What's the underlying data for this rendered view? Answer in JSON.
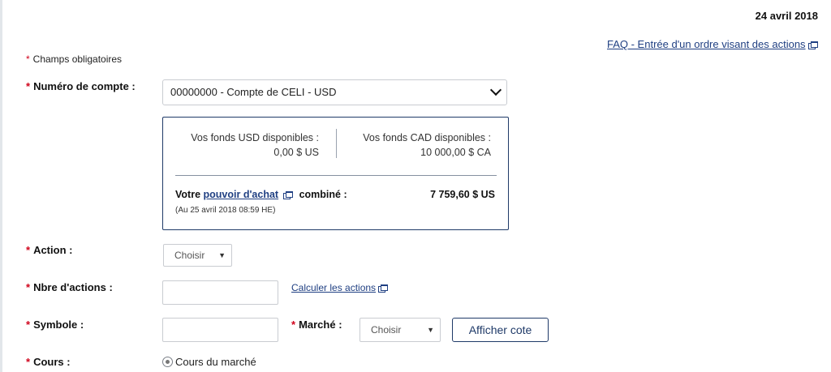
{
  "date": "24  avril 2018",
  "faq_link": "FAQ - Entrée d'un ordre visant des actions",
  "required_note": "Champs obligatoires",
  "required_marker": "*",
  "account": {
    "label": "Numéro de compte :",
    "selected": "00000000 - Compte de CELI - USD"
  },
  "funds": {
    "usd_label": "Vos fonds USD disponibles :",
    "usd_value": "0,00 $ US",
    "cad_label": "Vos fonds CAD disponibles :",
    "cad_value": "10 000,00  $ CA",
    "buying_prefix": "Votre",
    "buying_link": "pouvoir d'achat",
    "buying_suffix": "combiné :",
    "buying_value": "7 759,60 $ US",
    "as_of": "(Au 25 avril 2018 08:59 HE)"
  },
  "action": {
    "label": "Action :",
    "selected": "Choisir"
  },
  "shares": {
    "label": "Nbre d'actions :",
    "value": "",
    "calc_link": "Calculer les actions"
  },
  "symbol": {
    "label": "Symbole :",
    "value": ""
  },
  "market": {
    "label": "Marché :",
    "selected": "Choisir"
  },
  "quote_button": "Afficher cote",
  "price": {
    "label": "Cours :",
    "option_market": "Cours du marché"
  },
  "icons": {
    "external": "external-window-icon",
    "dropdown": "chevron-down-icon",
    "caret": "caret-down-icon"
  },
  "colors": {
    "link": "#1f3f82",
    "required": "#d0021b",
    "border_accent": "#1f3a68"
  }
}
